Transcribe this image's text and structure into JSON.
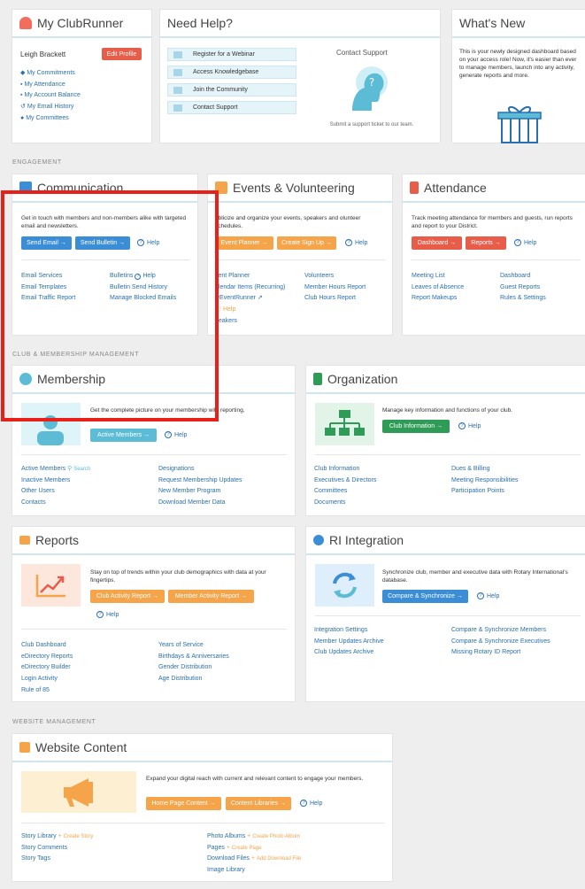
{
  "my_clubrunner": {
    "title": "My ClubRunner",
    "user_name": "Leigh Brackett",
    "edit_profile": "Edit Profile",
    "links": [
      "My Commitments",
      "My Attendance",
      "My Account Balance",
      "My Email History",
      "My Committees"
    ]
  },
  "need_help": {
    "title": "Need Help?",
    "items": [
      "Register for a Webinar",
      "Access Knowledgebase",
      "Join the Community",
      "Contact Support"
    ],
    "contact_title": "Contact Support",
    "contact_desc": "Submit a support ticket to our team."
  },
  "whats_new": {
    "title": "What's New",
    "text": "This is your newly designed dashboard based on your access role! Now, it's easier than ever to manage members, launch into any activity, generate reports and more."
  },
  "sections": {
    "engagement": "ENGAGEMENT",
    "club": "CLUB & MEMBERSHIP MANAGEMENT",
    "website": "WEBSITE MANAGEMENT"
  },
  "communication": {
    "title": "Communication",
    "desc": "Get in touch with members and non-members alike with targeted email and newsletters.",
    "send_email": "Send Email →",
    "send_bulletin": "Send Bulletin →",
    "help": "Help",
    "col1": [
      "Email Services",
      "Email Templates",
      "Email Traffic Report"
    ],
    "col2_bulletins": "Bulletins",
    "col2_help": "Help",
    "col2": [
      "Bulletin Send History",
      "Manage Blocked Emails"
    ]
  },
  "events": {
    "title": "Events & Volunteering",
    "desc": "ublicize and organize your events, speakers and olunteer schedules.",
    "event_planner": "Event Planner →",
    "create_signup": "Create Sign Up →",
    "help": "Help",
    "col1": [
      "vent Planner",
      "alendar Items (Recurring)",
      "lyEventRunner"
    ],
    "col1_help": "Help",
    "col1_last": "peakers",
    "col2": [
      "Volunteers",
      "Member Hours Report",
      "Club Hours Report"
    ]
  },
  "attendance": {
    "title": "Attendance",
    "desc": "Track meeting attendance for members and guests, run reports and report to your District.",
    "dashboard": "Dashboard →",
    "reports": "Reports →",
    "help": "Help",
    "col1": [
      "Meeting List",
      "Leaves of Absence",
      "Report Makeups"
    ],
    "col2": [
      "Dashboard",
      "Guest Reports",
      "Rules & Settings"
    ]
  },
  "membership": {
    "title": "Membership",
    "desc": "Get the complete picture on your membership with reporting,",
    "active_members_btn": "Active Members →",
    "help": "Help",
    "col1_first": "Active Members",
    "search": "Search",
    "col1": [
      "Inactive Members",
      "Other Users",
      "Contacts"
    ],
    "col2": [
      "Designations",
      "Request Membership Updates",
      "New Member Program",
      "Download Member Data"
    ]
  },
  "organization": {
    "title": "Organization",
    "desc": "Manage key information and functions of your club.",
    "club_info_btn": "Club Information →",
    "help": "Help",
    "col1": [
      "Club Information",
      "Executives & Directors",
      "Committees",
      "Documents"
    ],
    "col2": [
      "Dues & Billing",
      "Meeting Responsibilities",
      "Participation Points"
    ]
  },
  "reports": {
    "title": "Reports",
    "desc": "Stay on top of trends within your club demographics with data at your fingertips.",
    "club_activity": "Club Activity Report →",
    "member_activity": "Member Activity Report →",
    "help": "Help",
    "col1": [
      "Club Dashboard",
      "eDirectory Reports",
      "eDirectory Builder",
      "Login Activity",
      "Rule of 85"
    ],
    "col2": [
      "Years of Service",
      "Birthdays & Anniversaries",
      "Gender Distribution",
      "Age Distribution"
    ]
  },
  "ri": {
    "title": "RI Integration",
    "desc": "Synchronize club, member and executive data with Rotary International's database.",
    "compare_btn": "Compare & Synchronize →",
    "help": "Help",
    "col1": [
      "Integration Settings",
      "Member Updates Archive",
      "Club Updates Archive"
    ],
    "col2": [
      "Compare & Synchronize Members",
      "Compare & Synchronize Executives",
      "Missing Rotary ID Report"
    ]
  },
  "website": {
    "title": "Website Content",
    "desc": "Expand your digital reach with current and relevant content to engage your members.",
    "home_btn": "Home Page Content →",
    "libraries_btn": "Content Libraries →",
    "help": "Help",
    "story_library": "Story Library",
    "create_story": "Create Story",
    "col1": [
      "Story Comments",
      "Story Tags"
    ],
    "photo_albums": "Photo Albums",
    "create_album": "Create Photo Album",
    "pages": "Pages",
    "create_page": "Create Page",
    "download_files": "Download Files",
    "add_file": "Add Download File",
    "image_library": "Image Library"
  },
  "colors": {
    "highlight": "#e8201a",
    "accent_blue": "#3b8dd6",
    "accent_orange": "#f5a44a",
    "accent_red": "#e85c4a",
    "accent_green": "#2e9b57"
  }
}
